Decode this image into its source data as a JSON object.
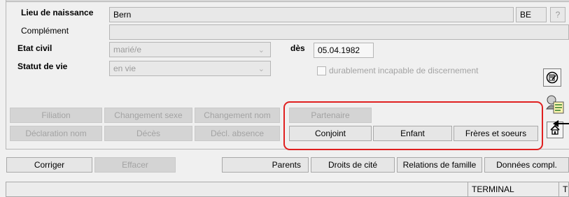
{
  "form": {
    "birthplace": {
      "label": "Lieu de naissance",
      "value": "Bern",
      "canton": "BE",
      "help": "?"
    },
    "complement": {
      "label": "Complément",
      "value": ""
    },
    "civil_status": {
      "label": "Etat civil",
      "value": "marié/e",
      "since_label": "dès",
      "since_value": "05.04.1982"
    },
    "life_status": {
      "label": "Statut de vie",
      "value": "en vie",
      "checkbox_label": "durablement incapable de discernement"
    }
  },
  "action_buttons": {
    "row1": [
      "Filiation",
      "Changement sexe",
      "Changement nom",
      "Partenaire"
    ],
    "row2": [
      "Déclaration nom",
      "Décès",
      "Décl. absence",
      "Conjoint",
      "Enfant",
      "Frères et soeurs"
    ]
  },
  "bottom_buttons": [
    "Corriger",
    "Effacer",
    "Parents",
    "Droits de cité",
    "Relations de famille",
    "Données compl."
  ],
  "status_bar": {
    "terminal": "TERMINAL",
    "extra": "T"
  },
  "icons": [
    "document-edit-icon",
    "person-card-icon",
    "home-icon",
    "arrow-left-icon"
  ],
  "colors": {
    "highlight_border": "#e02020"
  }
}
